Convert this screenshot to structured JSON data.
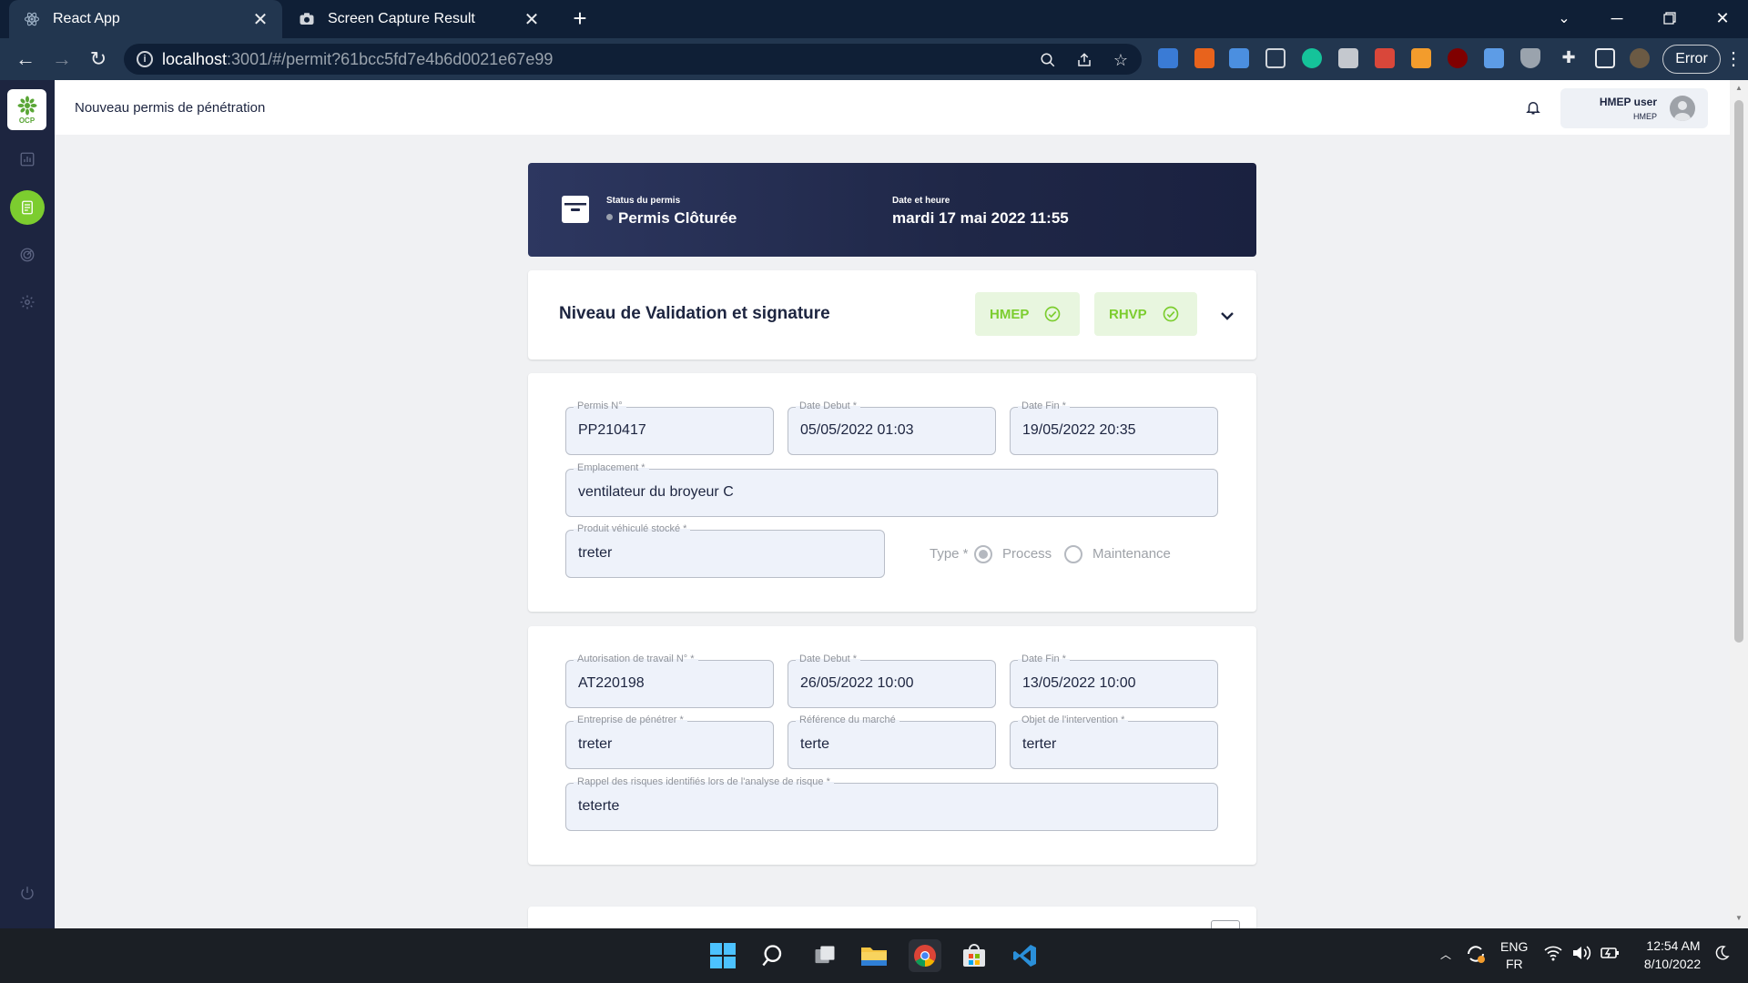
{
  "browser": {
    "tabs": [
      {
        "title": "React App",
        "icon": "react-icon",
        "active": true
      },
      {
        "title": "Screen Capture Result",
        "icon": "camera-icon",
        "active": false
      }
    ],
    "url_host": "localhost",
    "url_rest": ":3001/#/permit?61bcc5fd7e4b6d0021e67e99",
    "profile_status": "Error"
  },
  "app": {
    "page_title": "Nouveau permis de pénétration",
    "logo_text": "OCP",
    "user": {
      "name": "HMEP user",
      "role": "HMEP"
    },
    "sidebar": [
      {
        "name": "dashboard",
        "icon": "chart-icon",
        "active": false
      },
      {
        "name": "permits",
        "icon": "document-icon",
        "active": true
      },
      {
        "name": "radar",
        "icon": "radar-icon",
        "active": false
      },
      {
        "name": "settings",
        "icon": "gear-icon",
        "active": false
      },
      {
        "name": "logout",
        "icon": "power-icon",
        "active": false
      }
    ]
  },
  "status": {
    "status_label": "Status du permis",
    "status_value": "Permis Clôturée",
    "date_label": "Date et heure",
    "date_value": "mardi 17 mai 2022 11:55"
  },
  "validation": {
    "title": "Niveau de Validation et signature",
    "badges": [
      "HMEP",
      "RHVP"
    ],
    "accent": "#7ccd2f"
  },
  "permit": {
    "permit_no": {
      "label": "Permis N°",
      "value": "PP210417"
    },
    "date_debut": {
      "label": "Date Debut *",
      "value": "05/05/2022 01:03"
    },
    "date_fin": {
      "label": "Date Fin *",
      "value": "19/05/2022 20:35"
    },
    "emplacement": {
      "label": "Emplacement *",
      "value": "ventilateur du broyeur C"
    },
    "produit": {
      "label": "Produit véhiculé stocké *",
      "value": "treter"
    },
    "type_label": "Type *",
    "type_options": [
      "Process",
      "Maintenance"
    ],
    "type_selected": "Process"
  },
  "authorization": {
    "auth_no": {
      "label": "Autorisation de travail N° *",
      "value": "AT220198"
    },
    "date_debut": {
      "label": "Date Debut *",
      "value": "26/05/2022 10:00"
    },
    "date_fin": {
      "label": "Date Fin *",
      "value": "13/05/2022 10:00"
    },
    "entreprise": {
      "label": "Entreprise de pénétrer *",
      "value": "treter"
    },
    "reference": {
      "label": "Référence du marché",
      "value": "terte"
    },
    "objet": {
      "label": "Objet de l'intervention *",
      "value": "terter"
    },
    "rappel": {
      "label": "Rappel des risques identifiés lors de l'analyse de risque *",
      "value": "teterte"
    }
  },
  "taskbar": {
    "apps": [
      "windows-start-icon",
      "search-icon",
      "task-view-icon",
      "file-explorer-icon",
      "chrome-icon",
      "store-icon",
      "vscode-icon"
    ],
    "lang_top": "ENG",
    "lang_bottom": "FR",
    "time": "12:54 AM",
    "date": "8/10/2022"
  }
}
